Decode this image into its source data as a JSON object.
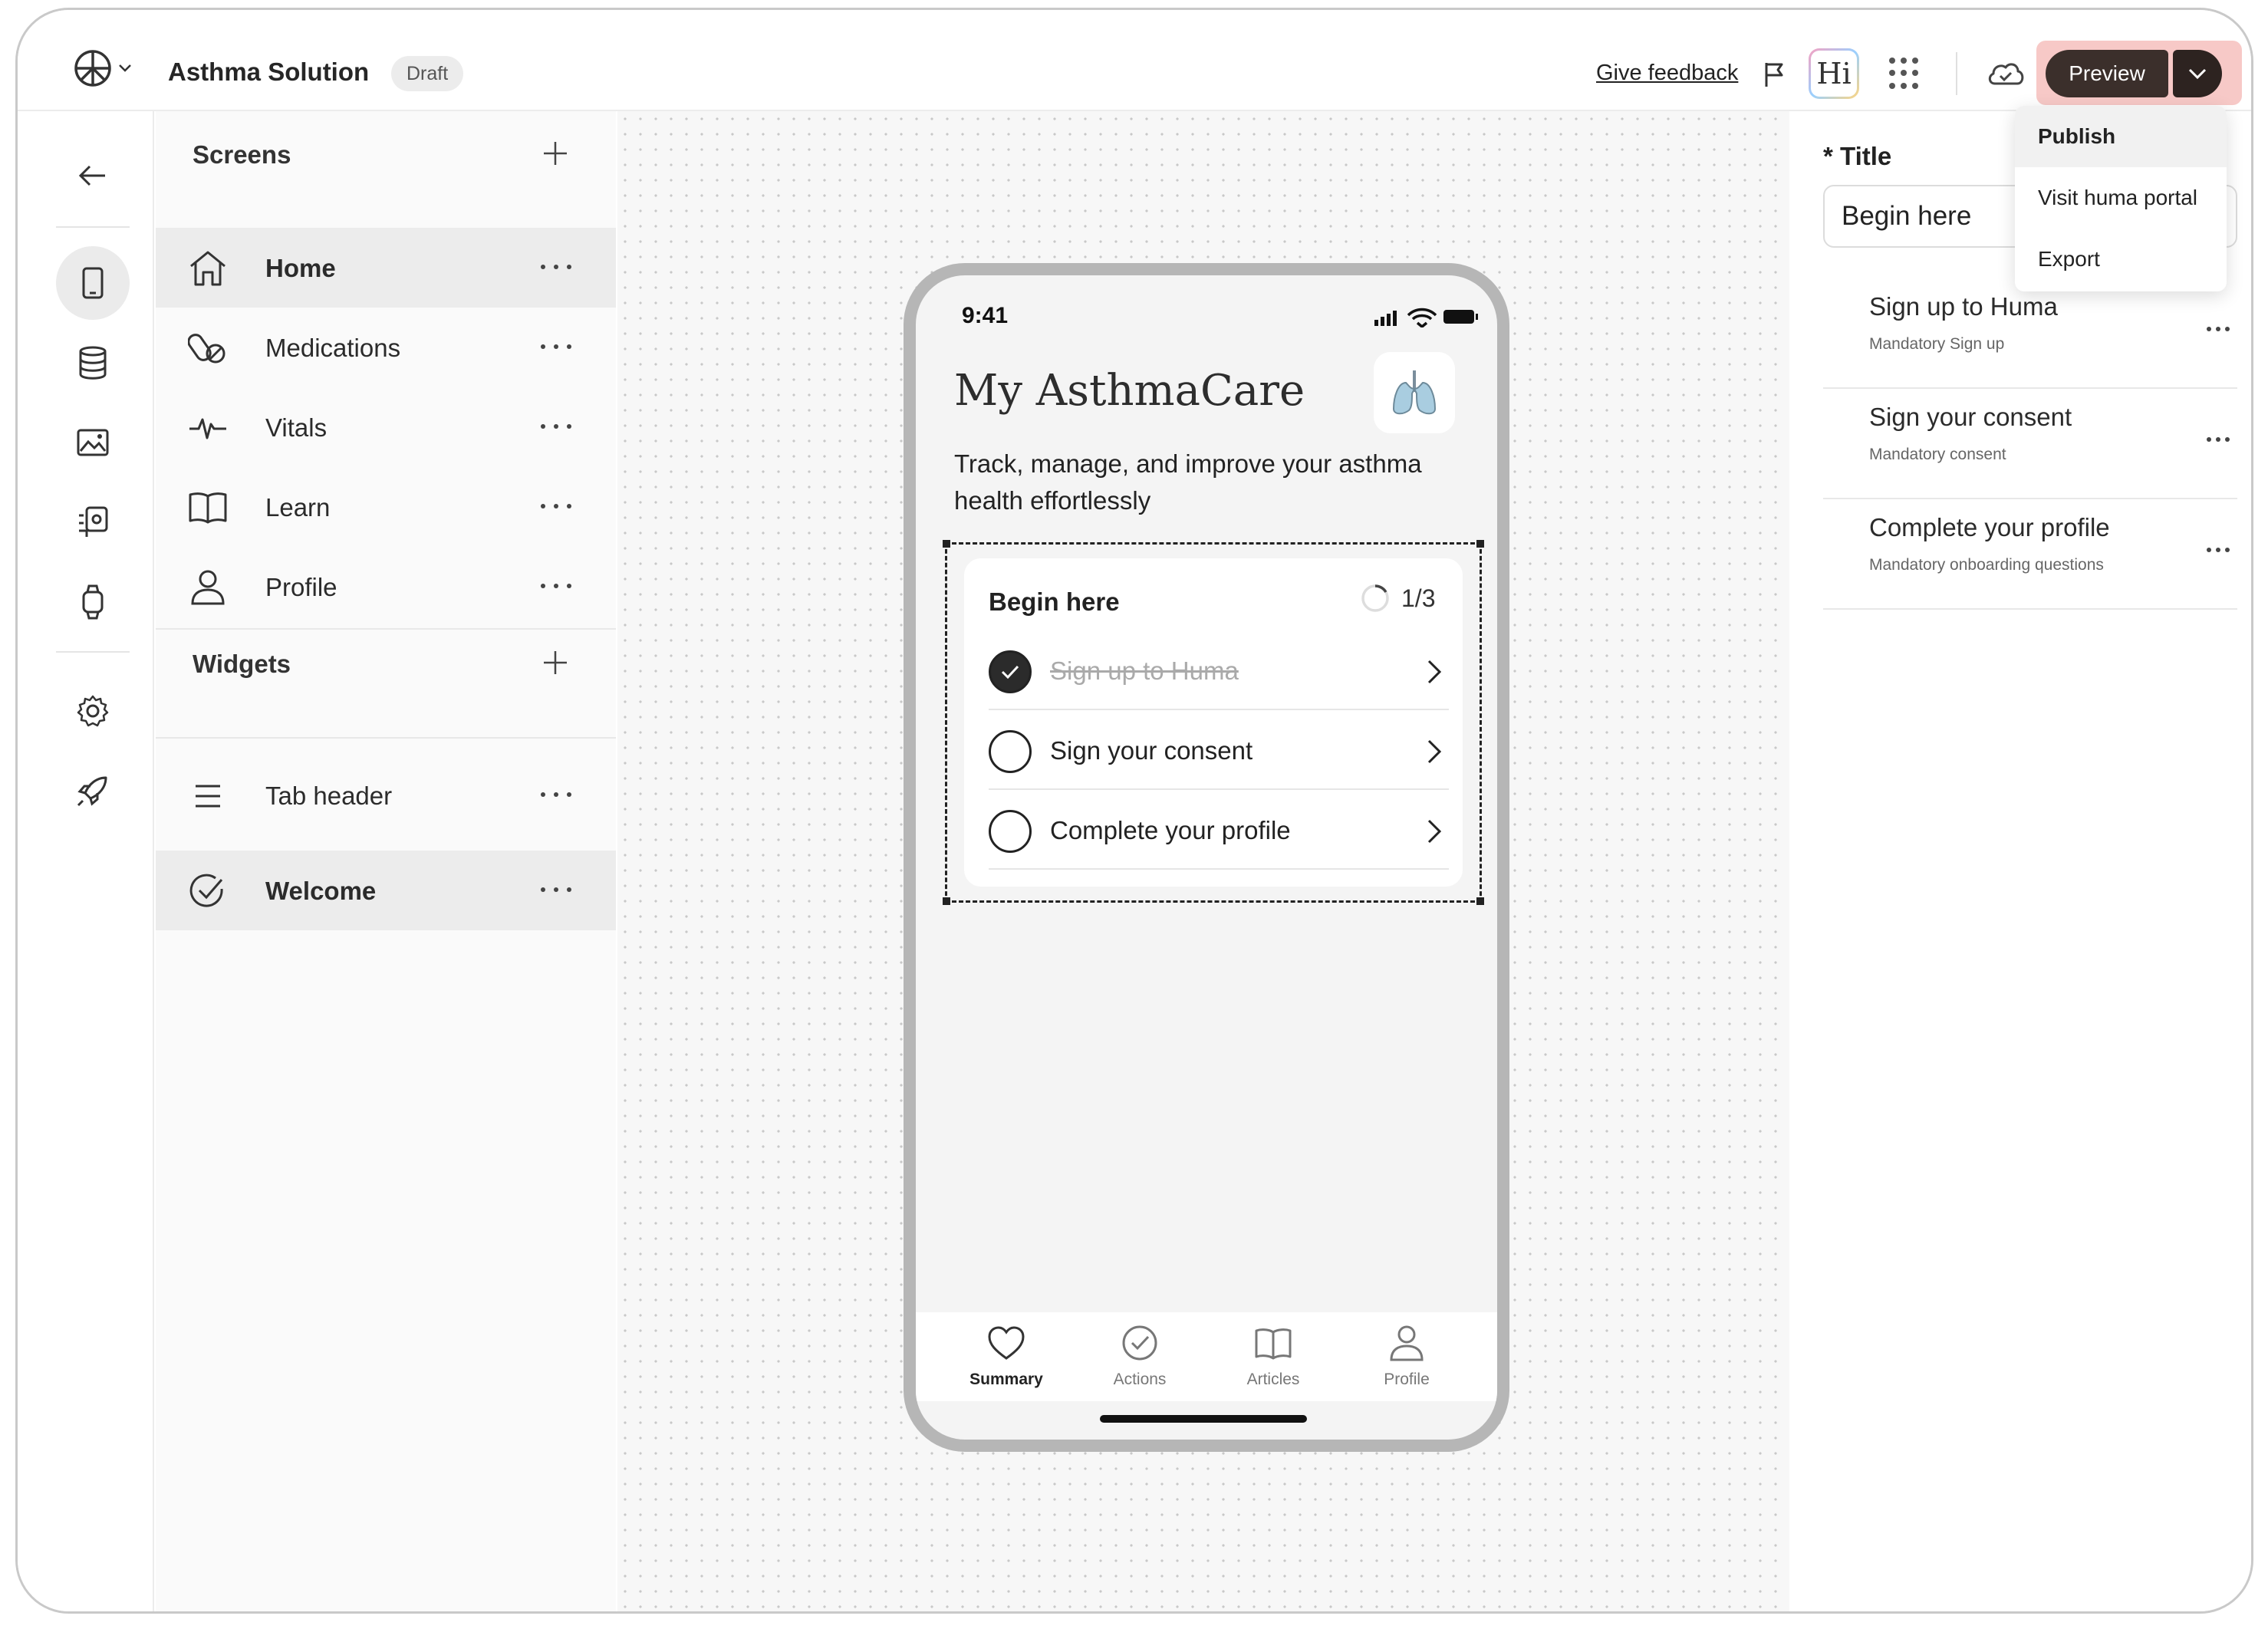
{
  "header": {
    "app_title": "Asthma Solution",
    "status_badge": "Draft",
    "feedback_label": "Give feedback",
    "ai_assistant_label": "Hi",
    "preview_label": "Preview"
  },
  "publish_menu": {
    "items": [
      {
        "label": "Publish",
        "active": true
      },
      {
        "label": "Visit huma portal"
      },
      {
        "label": "Export"
      }
    ]
  },
  "rail": {
    "items": [
      {
        "icon": "back-arrow-icon"
      },
      {
        "icon": "mobile-icon",
        "active": true
      },
      {
        "icon": "database-icon"
      },
      {
        "icon": "image-icon"
      },
      {
        "icon": "integration-icon"
      },
      {
        "icon": "watch-icon"
      },
      {
        "icon": "gear-icon"
      },
      {
        "icon": "rocket-icon"
      }
    ]
  },
  "screens": {
    "heading": "Screens",
    "items": [
      {
        "label": "Home",
        "icon": "home-icon",
        "active": true
      },
      {
        "label": "Medications",
        "icon": "pill-icon"
      },
      {
        "label": "Vitals",
        "icon": "pulse-icon"
      },
      {
        "label": "Learn",
        "icon": "book-icon"
      },
      {
        "label": "Profile",
        "icon": "user-icon"
      }
    ]
  },
  "widgets": {
    "heading": "Widgets",
    "items": [
      {
        "label": "Tab header",
        "icon": "lines-icon"
      },
      {
        "label": "Welcome",
        "icon": "check-circle-icon",
        "active": true
      }
    ]
  },
  "phone": {
    "time": "9:41",
    "title": "My AsthmaCare",
    "subtitle": "Track, manage, and improve your asthma health effortlessly",
    "card": {
      "title": "Begin here",
      "progress": "1/3",
      "tasks": [
        {
          "label": "Sign up to Huma",
          "done": true
        },
        {
          "label": "Sign your consent",
          "done": false
        },
        {
          "label": "Complete your profile",
          "done": false
        }
      ]
    },
    "tabs": [
      {
        "label": "Summary",
        "icon": "heart-icon",
        "active": true
      },
      {
        "label": "Actions",
        "icon": "check-circle-icon"
      },
      {
        "label": "Articles",
        "icon": "book-icon"
      },
      {
        "label": "Profile",
        "icon": "user-icon"
      }
    ]
  },
  "inspector": {
    "title_label": "* Title",
    "title_value": "Begin here",
    "items": [
      {
        "title": "Sign up to Huma",
        "subtitle": "Mandatory Sign up"
      },
      {
        "title": "Sign your consent",
        "subtitle": "Mandatory consent"
      },
      {
        "title": "Complete your profile",
        "subtitle": "Mandatory onboarding questions"
      }
    ]
  },
  "colors": {
    "preview_button": "#3b2f2b",
    "preview_group_bg": "#f7c9c7",
    "active_row": "#ececec"
  }
}
